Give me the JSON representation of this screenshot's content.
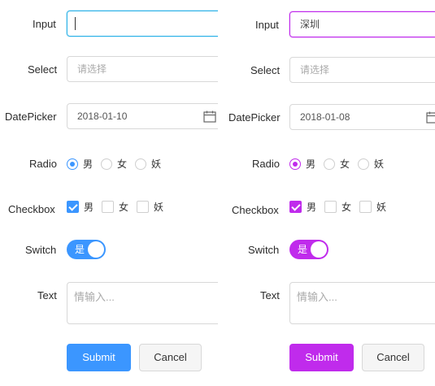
{
  "labels": {
    "input": "Input",
    "select": "Select",
    "datepicker": "DatePicker",
    "radio": "Radio",
    "checkbox": "Checkbox",
    "switch": "Switch",
    "text": "Text"
  },
  "left": {
    "accent_color": "#3b96ff",
    "input_value": "",
    "select_placeholder": "请选择",
    "date_value": "2018-01-10",
    "radio_options": [
      "男",
      "女",
      "妖"
    ],
    "radio_selected": "男",
    "checkbox_options": [
      "男",
      "女",
      "妖"
    ],
    "checkbox_checked": [
      "男"
    ],
    "switch_text": "是",
    "switch_on": true,
    "text_placeholder": "情输入...",
    "submit_label": "Submit",
    "cancel_label": "Cancel"
  },
  "right": {
    "accent_color": "#c02bec",
    "input_value": "深圳",
    "select_placeholder": "请选择",
    "date_value": "2018-01-08",
    "radio_options": [
      "男",
      "女",
      "妖"
    ],
    "radio_selected": "男",
    "checkbox_options": [
      "男",
      "女",
      "妖"
    ],
    "checkbox_checked": [
      "男"
    ],
    "switch_text": "是",
    "switch_on": true,
    "text_placeholder": "情输入...",
    "submit_label": "Submit",
    "cancel_label": "Cancel"
  },
  "icons": {
    "calendar": "calendar-icon"
  }
}
